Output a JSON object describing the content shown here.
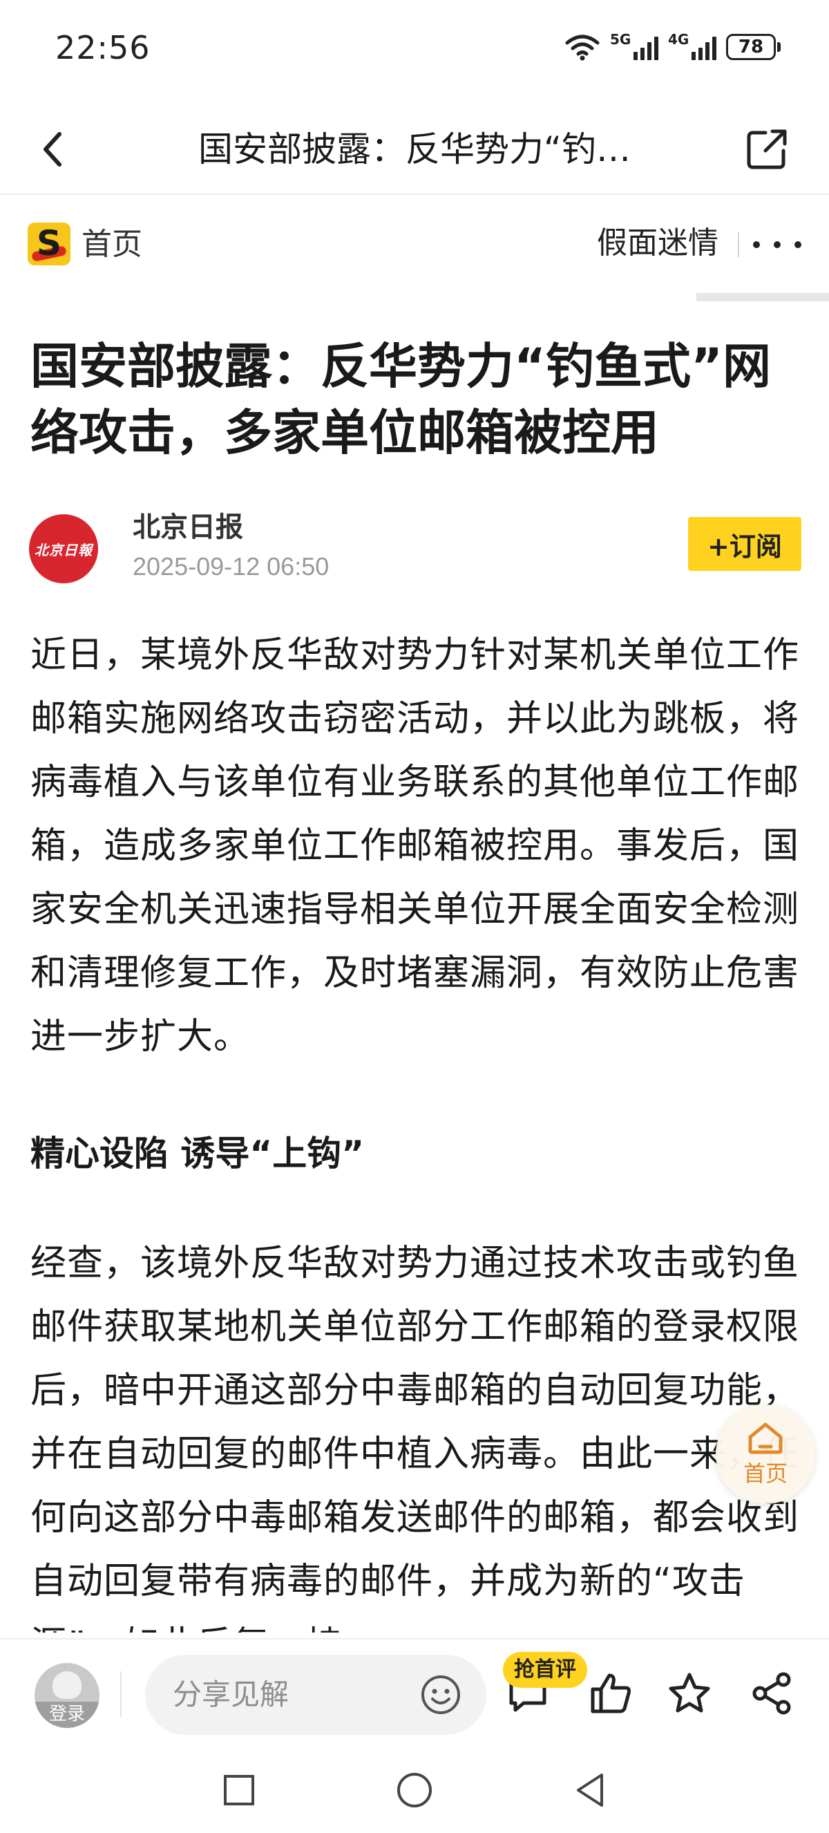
{
  "status_bar": {
    "time": "22:56",
    "signal_1_label": "5G",
    "signal_2_label": "4G",
    "battery": "78"
  },
  "navbar": {
    "title": "国安部披露：反华势力“钓…"
  },
  "channel": {
    "home_label": "首页",
    "channel_name": "假面迷情"
  },
  "article": {
    "title": "国安部披露：反华势力“钓鱼式”网络攻击，多家单位邮箱被控用",
    "author": {
      "avatar_text": "北京日報",
      "name": "北京日报",
      "date": "2025-09-12 06:50",
      "subscribe_label": "+订阅"
    },
    "paragraph_1": "近日，某境外反华敌对势力针对某机关单位工作邮箱实施网络攻击窃密活动，并以此为跳板，将病毒植入与该单位有业务联系的其他单位工作邮箱，造成多家单位工作邮箱被控用。事发后，国家安全机关迅速指导相关单位开展全面安全检测和清理修复工作，及时堵塞漏洞，有效防止危害进一步扩大。",
    "subheading": "精心设陷 诱导“上钩”",
    "paragraph_2": "经查，该境外反华敌对势力通过技术攻击或钓鱼邮件获取某地机关单位部分工作邮箱的登录权限后，暗中开通这部分中毒邮箱的自动回复功能，并在自动回复的邮件中植入病毒。由此一来，任何向这部分中毒邮箱发送邮件的邮箱，都会收到自动回复带有病毒的邮件，并成为新的“攻击源”，如此反复，持"
  },
  "float_home": {
    "label": "首页"
  },
  "bottom_bar": {
    "login_label": "登录",
    "comment_placeholder": "分享见解",
    "first_comment_badge": "抢首评"
  },
  "colors": {
    "accent_yellow": "#ffd21f",
    "brand_red": "#d8262e",
    "float_orange": "#e08a2a"
  },
  "icons": {
    "back": "chevron-left-icon",
    "share": "share-out-icon",
    "more": "more-dots-icon",
    "comment": "comment-icon",
    "like": "thumbs-up-icon",
    "favorite": "star-icon",
    "share_bottom": "share-nodes-icon"
  }
}
